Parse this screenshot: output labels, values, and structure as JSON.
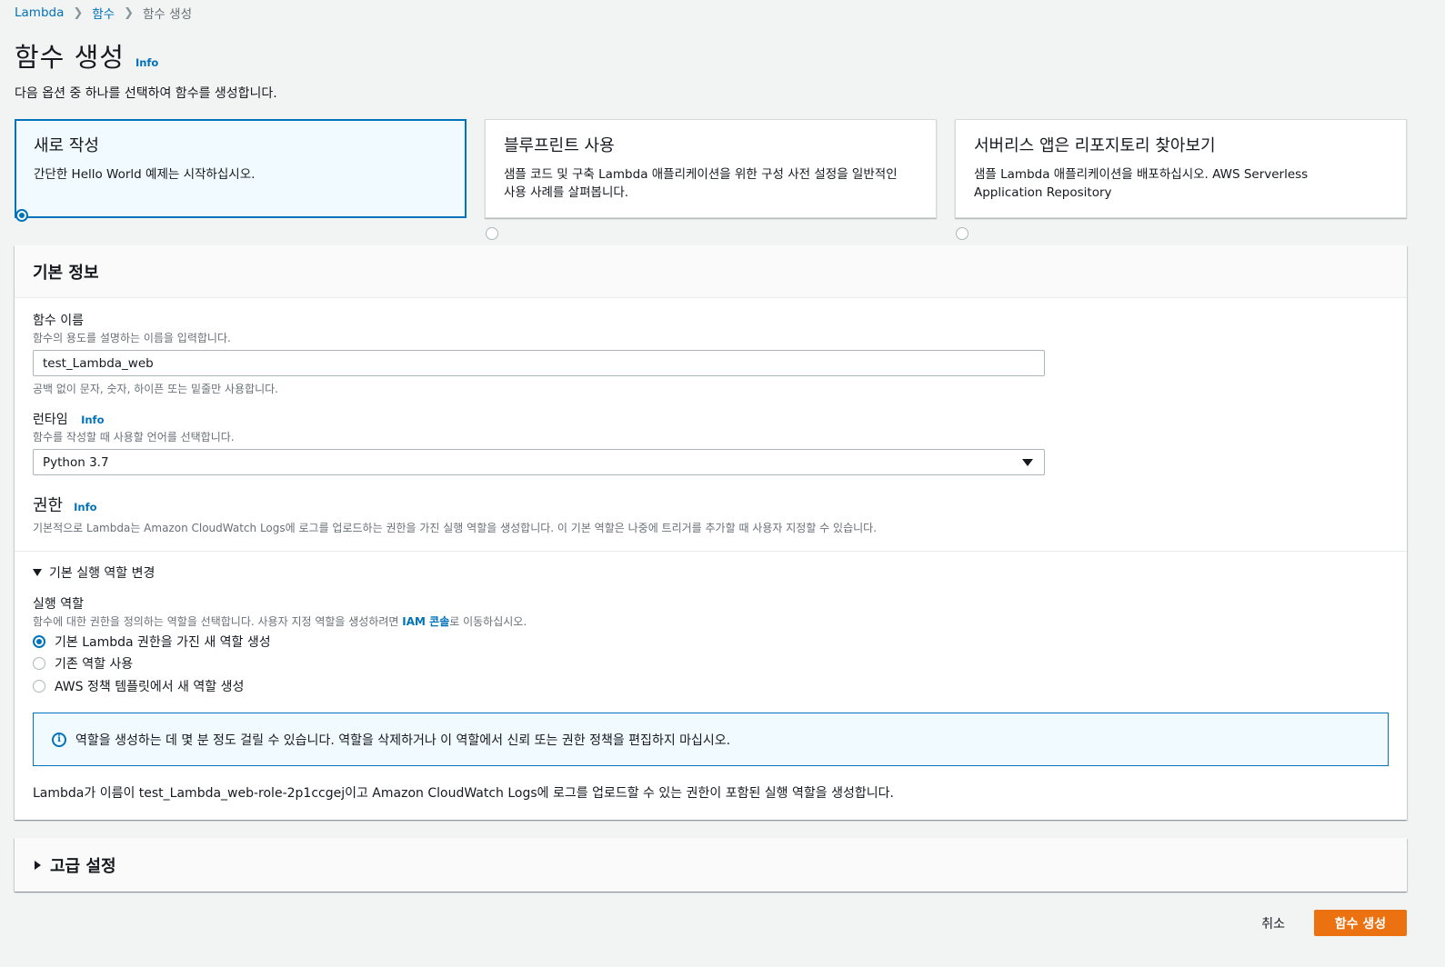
{
  "breadcrumb": {
    "root": "Lambda",
    "parent": "함수",
    "current": "함수 생성"
  },
  "page": {
    "title": "함수 생성",
    "info": "Info",
    "subtitle": "다음 옵션 중 하나를 선택하여 함수를 생성합니다."
  },
  "options": [
    {
      "title": "새로 작성",
      "desc": "간단한 Hello World 예제는 시작하십시오.",
      "selected": true
    },
    {
      "title": "블루프린트 사용",
      "desc": "샘플 코드 및 구축 Lambda 애플리케이션을 위한 구성 사전 설정을 일반적인 사용 사례를 살펴봅니다.",
      "selected": false
    },
    {
      "title": "서버리스 앱은 리포지토리 찾아보기",
      "desc": "샘플 Lambda 애플리케이션을 배포하십시오. AWS Serverless Application Repository",
      "selected": false
    }
  ],
  "basic": {
    "header": "기본 정보",
    "function_name": {
      "label": "함수 이름",
      "desc": "함수의 용도를 설명하는 이름을 입력합니다.",
      "value": "test_Lambda_web",
      "constraint": "공백 없이 문자, 숫자, 하이픈 또는 밑줄만 사용합니다."
    },
    "runtime": {
      "label": "런타임",
      "info": "Info",
      "desc": "함수를 작성할 때 사용할 언어를 선택합니다.",
      "value": "Python 3.7"
    },
    "permissions": {
      "label": "권한",
      "info": "Info",
      "desc": "기본적으로 Lambda는 Amazon CloudWatch Logs에 로그를 업로드하는 권한을 가진 실행 역할을 생성합니다. 이 기본 역할은 나중에 트리거를 추가할 때 사용자 지정할 수 있습니다."
    },
    "expander": "기본 실행 역할 변경",
    "exec_role": {
      "label": "실행 역할",
      "desc_before": "함수에 대한 권한을 정의하는 역할을 선택합니다. 사용자 지정 역할을 생성하려면 ",
      "desc_link": "IAM 콘솔",
      "desc_after": "로 이동하십시오.",
      "choices": [
        {
          "label": "기본 Lambda 권한을 가진 새 역할 생성",
          "selected": true
        },
        {
          "label": "기존 역할 사용",
          "selected": false
        },
        {
          "label": "AWS 정책 템플릿에서 새 역할 생성",
          "selected": false
        }
      ]
    },
    "info_box": "역할을 생성하는 데 몇 분 정도 걸릴 수 있습니다. 역할을 삭제하거나 이 역할에서 신뢰 또는 권한 정책을 편집하지 마십시오.",
    "result_note": "Lambda가 이름이 test_Lambda_web-role-2p1ccgej이고 Amazon CloudWatch Logs에 로그를 업로드할 수 있는 권한이 포함된 실행 역할을 생성합니다."
  },
  "advanced": {
    "header": "고급 설정"
  },
  "actions": {
    "cancel": "취소",
    "create": "함수 생성"
  },
  "colors": {
    "accent": "#0073bb",
    "primary_button": "#ec7211"
  }
}
